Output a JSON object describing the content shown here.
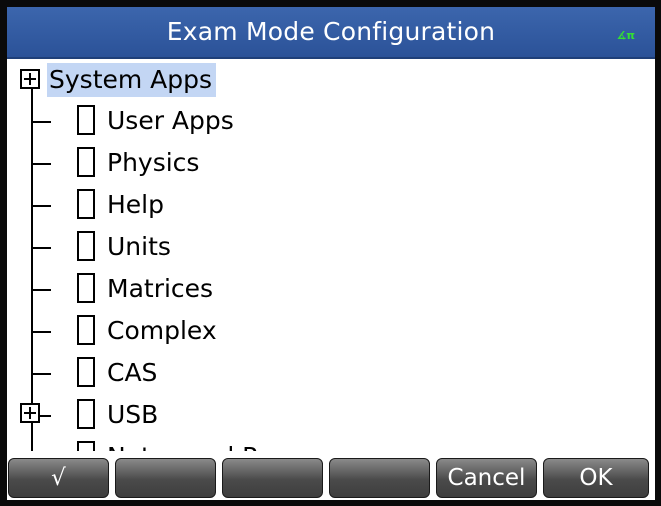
{
  "window": {
    "title": "Exam Mode Configuration",
    "mode_indicator": "∡π"
  },
  "tree": {
    "root": {
      "label": "System Apps",
      "selected": true
    },
    "items": [
      {
        "label": "User Apps",
        "checked": false,
        "expandable": false
      },
      {
        "label": "Physics",
        "checked": false,
        "expandable": false
      },
      {
        "label": "Help",
        "checked": false,
        "expandable": false
      },
      {
        "label": "Units",
        "checked": false,
        "expandable": false
      },
      {
        "label": "Matrices",
        "checked": false,
        "expandable": false
      },
      {
        "label": "Complex",
        "checked": false,
        "expandable": false
      },
      {
        "label": "CAS",
        "checked": false,
        "expandable": false
      },
      {
        "label": "USB",
        "checked": false,
        "expandable": true
      },
      {
        "label": "Notes and Programs",
        "checked": false,
        "expandable": false
      }
    ]
  },
  "softkeys": [
    {
      "label": "√"
    },
    {
      "label": ""
    },
    {
      "label": ""
    },
    {
      "label": ""
    },
    {
      "label": "Cancel"
    },
    {
      "label": "OK"
    }
  ],
  "colors": {
    "titlebar": "#2b5298",
    "selection": "#c3d6f4",
    "softkey": "#4a4a4a",
    "mode_indicator": "#32e032"
  }
}
